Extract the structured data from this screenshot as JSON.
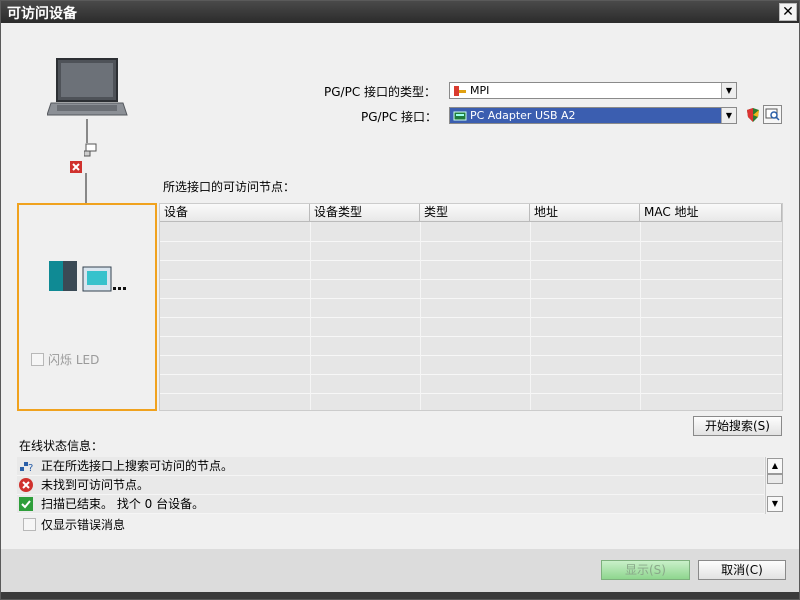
{
  "window": {
    "title": "可访问设备",
    "close_label": "✕"
  },
  "interface": {
    "type_label": "PG/PC 接口的类型：",
    "type_value": "MPI",
    "port_label": "PG/PC 接口：",
    "port_value": "PC Adapter USB A2"
  },
  "nodes_label": "所选接口的可访问节点：",
  "table": {
    "columns": [
      "设备",
      "设备类型",
      "类型",
      "地址",
      "MAC 地址"
    ],
    "rows": []
  },
  "flash_led_label": "闪烁 LED",
  "search_button": "开始搜索(S)",
  "status": {
    "label": "在线状态信息：",
    "messages": [
      {
        "icon": "search-network-icon",
        "text": "正在所选接口上搜索可访问的节点。"
      },
      {
        "icon": "error-icon",
        "text": "未找到可访问节点。"
      },
      {
        "icon": "success-check-icon",
        "text": "扫描已结束。 找个 0 台设备。"
      }
    ]
  },
  "show_errors_only_label": "仅显示错误消息",
  "buttons": {
    "show": "显示(S)",
    "cancel": "取消(C)"
  },
  "colors": {
    "highlight_border": "#f0a21e",
    "selected_field": "#3b5eb0",
    "show_button": "#8ed68e"
  }
}
